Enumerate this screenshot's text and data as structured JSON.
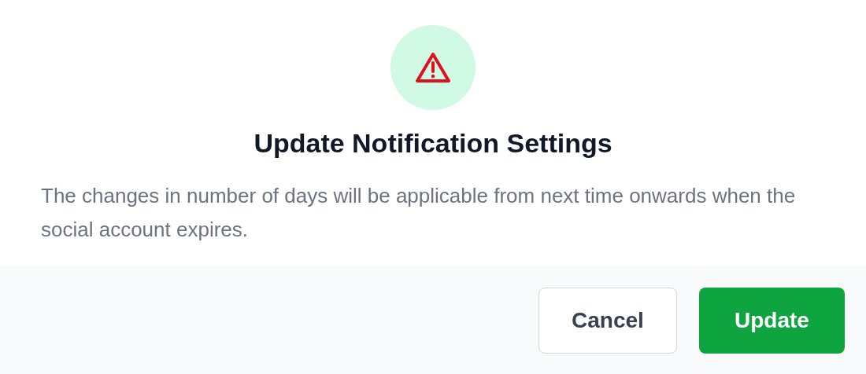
{
  "dialog": {
    "title": "Update Notification Settings",
    "message": "The changes in number of days will be applicable from next time onwards when the social account expires.",
    "buttons": [
      {
        "label": "Cancel",
        "kind": "secondary"
      },
      {
        "label": "Update",
        "kind": "primary"
      }
    ]
  }
}
